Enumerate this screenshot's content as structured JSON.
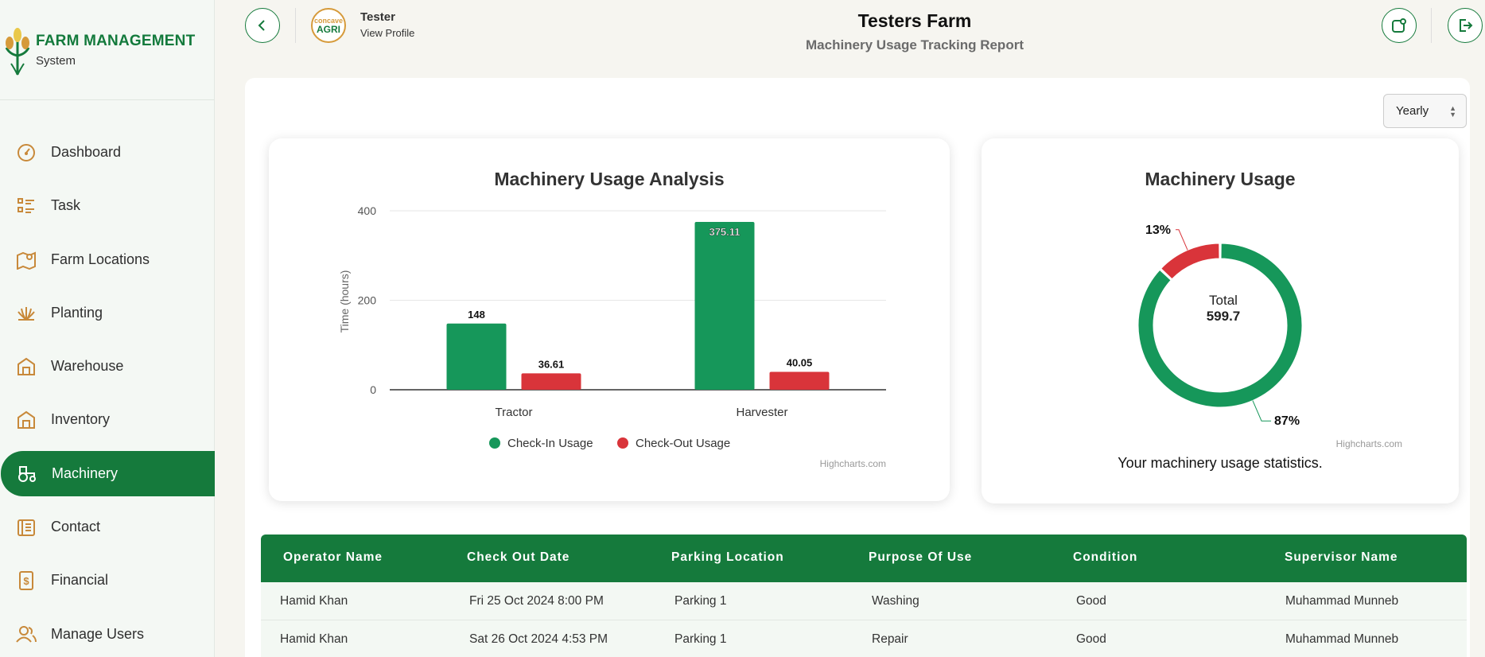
{
  "brand": {
    "title": "FARM MANAGEMENT",
    "subtitle": "System"
  },
  "sidebar": {
    "items": [
      {
        "label": "Dashboard",
        "icon": "dashboard-icon"
      },
      {
        "label": "Task",
        "icon": "task-list-icon"
      },
      {
        "label": "Farm Locations",
        "icon": "map-pin-icon"
      },
      {
        "label": "Planting",
        "icon": "plant-icon"
      },
      {
        "label": "Warehouse",
        "icon": "warehouse-icon"
      },
      {
        "label": "Inventory",
        "icon": "inventory-icon"
      },
      {
        "label": "Machinery",
        "icon": "tractor-icon",
        "active": true
      },
      {
        "label": "Contact",
        "icon": "contact-icon"
      },
      {
        "label": "Financial",
        "icon": "financial-icon"
      },
      {
        "label": "Manage Users",
        "icon": "users-icon"
      }
    ]
  },
  "header": {
    "user_name": "Tester",
    "profile_link": "View Profile",
    "logo_text_1": "concave",
    "logo_text_2": "AGRI",
    "farm_title": "Testers Farm",
    "report_title": "Machinery Usage Tracking Report"
  },
  "period_select": {
    "value": "Yearly"
  },
  "colors": {
    "primary": "#157a3c",
    "bar_green": "#16975a",
    "bar_red": "#d9343a"
  },
  "chart_data": [
    {
      "type": "bar",
      "title": "Machinery Usage Analysis",
      "xlabel": "",
      "ylabel": "Time (hours)",
      "categories": [
        "Tractor",
        "Harvester"
      ],
      "series": [
        {
          "name": "Check-In Usage",
          "color": "#16975a",
          "values": [
            148,
            375.11
          ],
          "labels": [
            "148",
            "375.11"
          ]
        },
        {
          "name": "Check-Out Usage",
          "color": "#d9343a",
          "values": [
            36.61,
            40.05
          ],
          "labels": [
            "36.61",
            "40.05"
          ]
        }
      ],
      "ylim": [
        0,
        400
      ],
      "yticks": [
        "0",
        "200",
        "400"
      ],
      "grid": true,
      "legend": "bottom",
      "credits": "Highcharts.com"
    },
    {
      "type": "pie",
      "title": "Machinery Usage",
      "center_label": "Total",
      "center_value": "599.7",
      "slices": [
        {
          "label": "87%",
          "value": 87,
          "color": "#16975a"
        },
        {
          "label": "13%",
          "value": 13,
          "color": "#d9343a"
        }
      ],
      "caption": "Your machinery usage statistics.",
      "credits": "Highcharts.com"
    }
  ],
  "table": {
    "headers": [
      "Operator Name",
      "Check Out Date",
      "Parking Location",
      "Purpose Of Use",
      "Condition",
      "Supervisor Name"
    ],
    "rows": [
      [
        "Hamid Khan",
        "Fri 25 Oct 2024 8:00 PM",
        "Parking 1",
        "Washing",
        "Good",
        "Muhammad Munneb"
      ],
      [
        "Hamid Khan",
        "Sat 26 Oct 2024 4:53 PM",
        "Parking 1",
        "Repair",
        "Good",
        "Muhammad Munneb"
      ]
    ]
  }
}
